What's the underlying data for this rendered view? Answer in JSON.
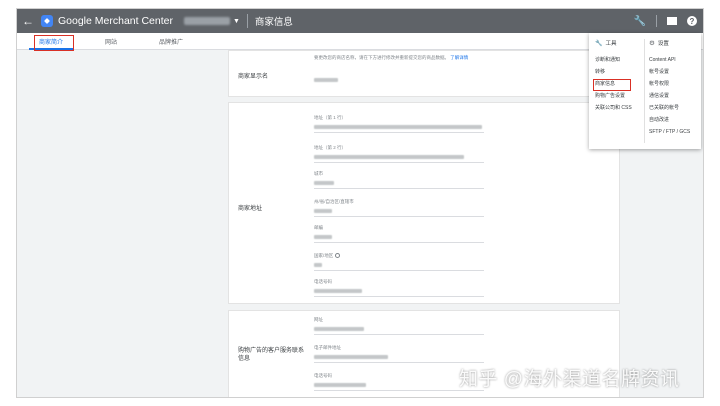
{
  "header": {
    "back_icon": "arrow-left-icon",
    "app_title": "Google Merchant Center",
    "page_title": "商家信息",
    "icons": [
      "wrench-icon",
      "mail-icon",
      "help-icon"
    ]
  },
  "tabs": [
    {
      "label": "商家简介",
      "active": true
    },
    {
      "label": "网站",
      "active": false
    },
    {
      "label": "品牌推广",
      "active": false
    }
  ],
  "card_display": {
    "label": "商家显示名",
    "description": "要更改您的商店名称，请在下方进行修改并重新提交您的商品数据。",
    "learn_more": "了解详情"
  },
  "card_address": {
    "label": "商家地址",
    "fields": [
      {
        "label": "地址（第 1 行）"
      },
      {
        "label": "地址（第 2 行）"
      },
      {
        "label": "城市"
      },
      {
        "label": "州/省/自治区/直辖市"
      },
      {
        "label": "邮编"
      },
      {
        "label": "国家/地区"
      },
      {
        "label": "电话号码"
      }
    ]
  },
  "card_contact": {
    "label": "购物广告的客户服务联系信息",
    "fields": [
      {
        "label": "网址"
      },
      {
        "label": "电子邮件地址"
      },
      {
        "label": "电话号码"
      }
    ]
  },
  "dropdown": {
    "tools": {
      "title": "工具",
      "items": [
        "诊断和通知",
        "转移",
        "商家信息",
        "购物广告设置",
        "关联公司和 CSS"
      ],
      "selected": "商家信息"
    },
    "settings": {
      "title": "设置",
      "items": [
        "Content API",
        "帐号设置",
        "帐号权限",
        "通信设置",
        "已关联的帐号",
        "自动改进",
        "SFTP / FTP / GCS"
      ]
    }
  },
  "watermark": "知乎 @海外渠道名牌资讯"
}
